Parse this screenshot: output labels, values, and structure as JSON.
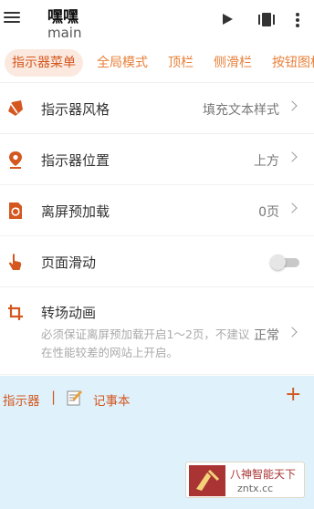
{
  "appbar": {
    "title": "嘿嘿",
    "subtitle": "main"
  },
  "tabs": [
    {
      "label": "指示器菜单",
      "active": true
    },
    {
      "label": "全局模式",
      "active": false
    },
    {
      "label": "顶栏",
      "active": false
    },
    {
      "label": "侧滑栏",
      "active": false
    },
    {
      "label": "按钮图标",
      "active": false
    }
  ],
  "settings": {
    "style": {
      "label": "指示器风格",
      "value": "填充文本样式"
    },
    "position": {
      "label": "指示器位置",
      "value": "上方"
    },
    "preload": {
      "label": "离屏预加载",
      "value": "0页"
    },
    "scroll": {
      "label": "页面滑动",
      "enabled": false
    },
    "transition": {
      "label": "转场动画",
      "description": "必须保证离屏预加载开启1～2页，不建议在性能较差的网站上开启。",
      "value": "正常"
    }
  },
  "panel": {
    "item1": "指示器",
    "separator": "|",
    "item2": "记事本",
    "add": "+"
  },
  "watermark": {
    "line1": "八神智能天下",
    "line2": "zntx.cc"
  },
  "colors": {
    "accent": "#d4571f",
    "tab_accent": "#e8803a",
    "active_tab_bg": "#fbe9df",
    "panel_bg": "#dff1fb"
  }
}
